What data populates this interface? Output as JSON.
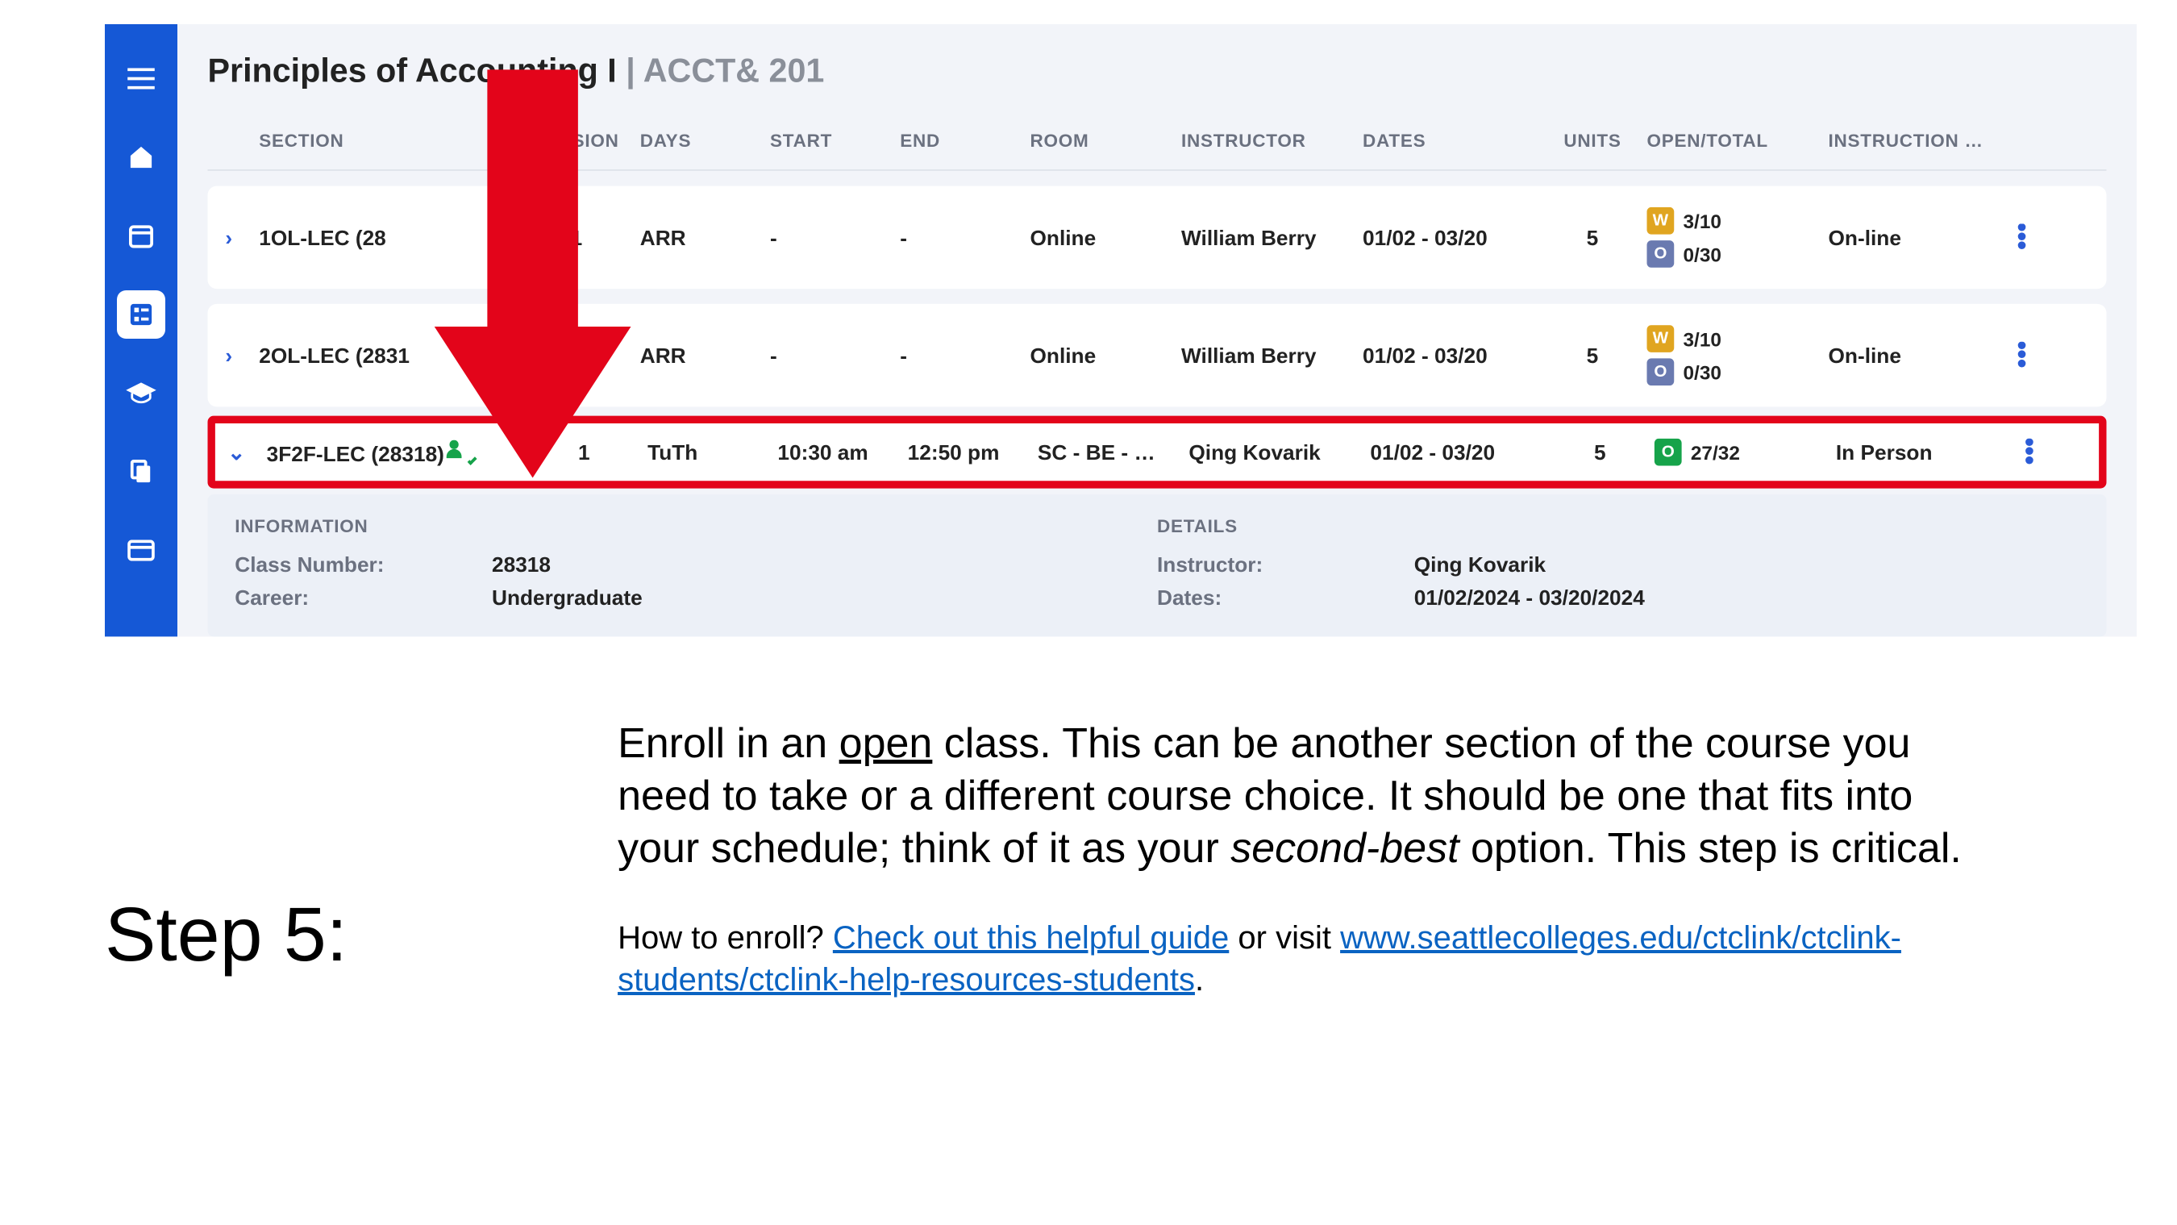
{
  "course": {
    "title": "Principles of Accounting I",
    "code": "ACCT& 201"
  },
  "columns": {
    "section": "SECTION",
    "session": "SESSION",
    "days": "DAYS",
    "start": "START",
    "end": "END",
    "room": "ROOM",
    "instructor": "INSTRUCTOR",
    "dates": "DATES",
    "units": "UNITS",
    "open_total": "OPEN/TOTAL",
    "mode": "INSTRUCTION MODE"
  },
  "rows": [
    {
      "expanded": false,
      "section": "1OL-LEC (28",
      "session": "1",
      "days": "ARR",
      "start": "-",
      "end": "-",
      "room": "Online",
      "instructor": "William Berry",
      "dates": "01/02 - 03/20",
      "units": "5",
      "open_lines": [
        {
          "badge": "W",
          "value": "3/10"
        },
        {
          "badge": "O",
          "badge_style": "grey",
          "value": "0/30"
        }
      ],
      "mode": "On-line"
    },
    {
      "expanded": false,
      "section": "2OL-LEC (2831",
      "session": "1",
      "days": "ARR",
      "start": "-",
      "end": "-",
      "room": "Online",
      "instructor": "William Berry",
      "dates": "01/02 - 03/20",
      "units": "5",
      "open_lines": [
        {
          "badge": "W",
          "value": "3/10"
        },
        {
          "badge": "O",
          "badge_style": "grey",
          "value": "0/30"
        }
      ],
      "mode": "On-line"
    },
    {
      "expanded": true,
      "highlighted": true,
      "section": "3F2F-LEC (28318)",
      "has_person_check": true,
      "session": "1",
      "days": "TuTh",
      "start": "10:30 am",
      "end": "12:50 pm",
      "room": "SC - BE - G…",
      "instructor": "Qing Kovarik",
      "dates": "01/02 - 03/20",
      "units": "5",
      "open_lines": [
        {
          "badge": "O",
          "badge_style": "green",
          "value": "27/32"
        }
      ],
      "mode": "In Person"
    }
  ],
  "details": {
    "info_label": "INFORMATION",
    "class_number_label": "Class Number:",
    "class_number_value": "28318",
    "career_label": "Career:",
    "career_value": "Undergraduate",
    "details_label": "DETAILS",
    "instructor_label": "Instructor:",
    "instructor_value": "Qing Kovarik",
    "dates_label": "Dates:",
    "dates_value": "01/02/2024 - 03/20/2024"
  },
  "instructions": {
    "step_label": "Step 5:",
    "para1_a": "Enroll in an ",
    "para1_open": "open",
    "para1_b": " class. This can be another section of the course you need to take or a different course choice. It should be one that fits into your schedule; think of it as your ",
    "para1_sb": "second-best",
    "para1_c": " option. This step is critical.",
    "para2_a": "How to enroll? ",
    "para2_link1": "Check out this helpful guide",
    "para2_b": " or visit ",
    "para2_link2": "www.seattlecolleges.edu/ctclink/ctclink-students/ctclink-help-resources-students",
    "para2_c": "."
  }
}
